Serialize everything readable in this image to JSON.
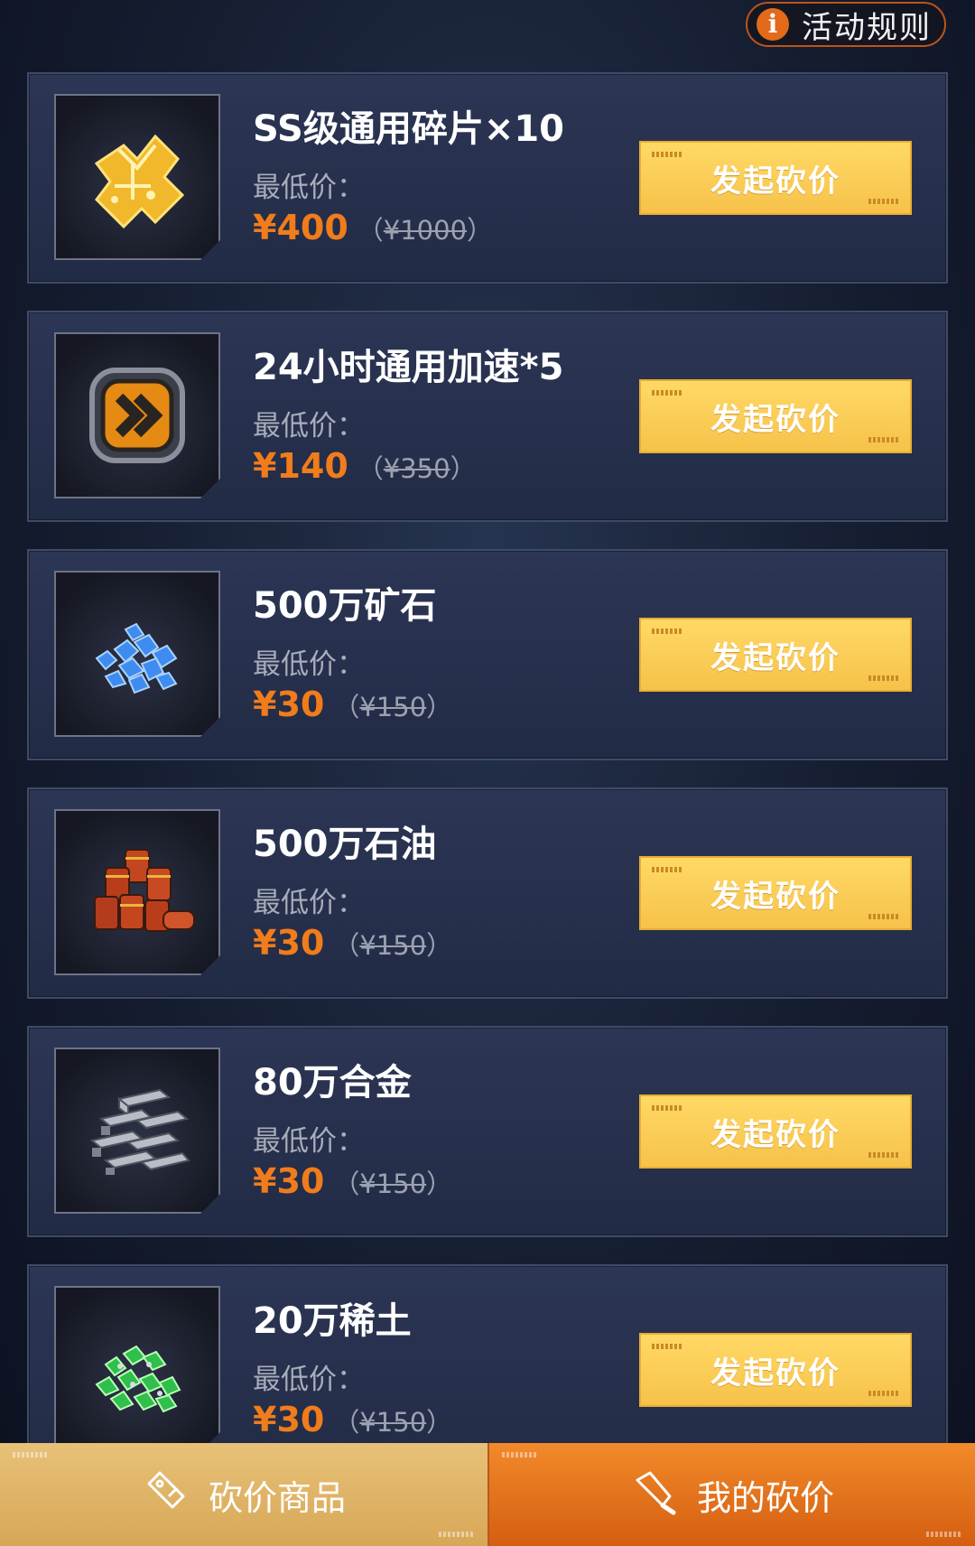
{
  "header": {
    "rules_label": "活动规则"
  },
  "items": [
    {
      "title": "SS级通用碎片×10",
      "min_label": "最低价：",
      "price": "¥400",
      "orig_open": "（",
      "original_price": "¥1000",
      "orig_close": "）",
      "cta": "发起砍价",
      "icon": "gold-puzzle-fragment-icon"
    },
    {
      "title": "24小时通用加速*5",
      "min_label": "最低价：",
      "price": "¥140",
      "orig_open": "（",
      "original_price": "¥350",
      "orig_close": "）",
      "cta": "发起砍价",
      "icon": "speedup-chevron-icon"
    },
    {
      "title": "500万矿石",
      "min_label": "最低价：",
      "price": "¥30",
      "orig_open": "（",
      "original_price": "¥150",
      "orig_close": "）",
      "cta": "发起砍价",
      "icon": "blue-ore-icon"
    },
    {
      "title": "500万石油",
      "min_label": "最低价：",
      "price": "¥30",
      "orig_open": "（",
      "original_price": "¥150",
      "orig_close": "）",
      "cta": "发起砍价",
      "icon": "oil-barrels-icon"
    },
    {
      "title": "80万合金",
      "min_label": "最低价：",
      "price": "¥30",
      "orig_open": "（",
      "original_price": "¥150",
      "orig_close": "）",
      "cta": "发起砍价",
      "icon": "alloy-ingots-icon"
    },
    {
      "title": "20万稀土",
      "min_label": "最低价：",
      "price": "¥30",
      "orig_open": "（",
      "original_price": "¥150",
      "orig_close": "）",
      "cta": "发起砍价",
      "icon": "green-rare-earth-icon"
    }
  ],
  "tabs": {
    "goods_label": "砍价商品",
    "mine_label": "我的砍价"
  },
  "colors": {
    "accent_orange": "#f07c1c",
    "button_yellow": "#f6c24a",
    "tab_active": "#d45e10"
  }
}
